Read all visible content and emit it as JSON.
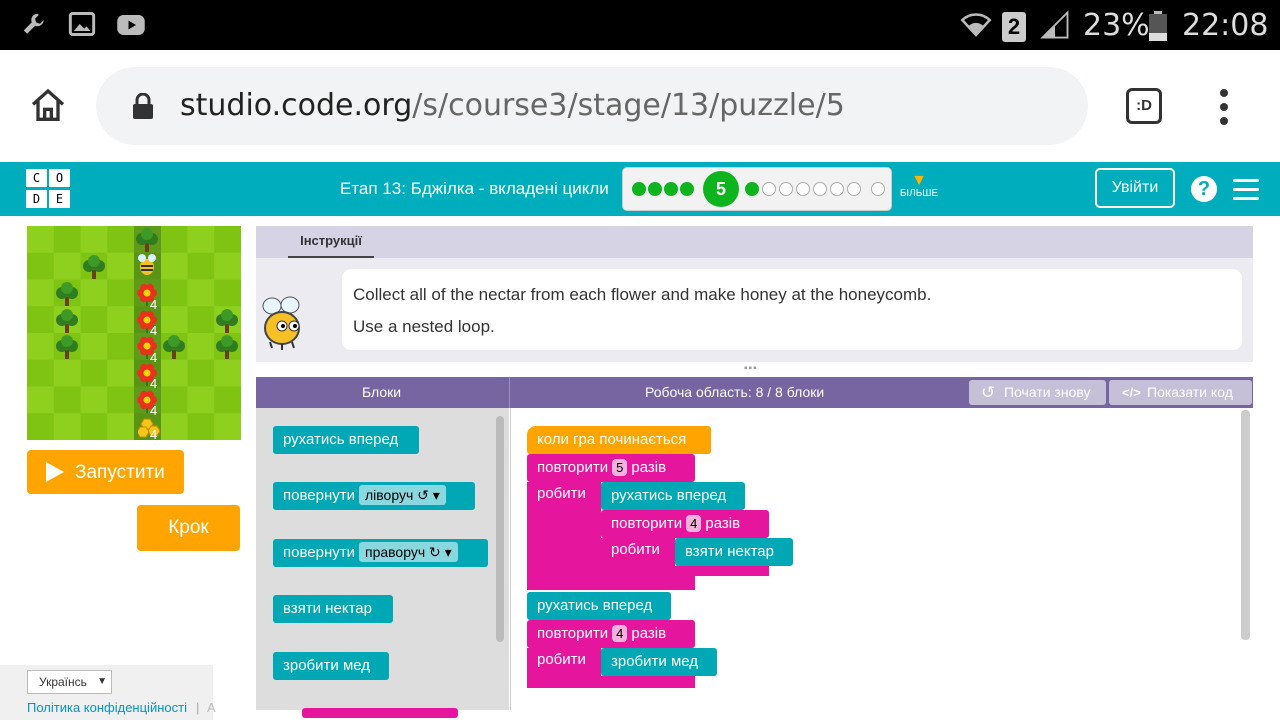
{
  "status_bar": {
    "battery": "23%",
    "time": "22:08",
    "sim": "2"
  },
  "browser": {
    "url_host": "studio.code.org",
    "url_path": "/s/course3/stage/13/puzzle/5",
    "tab_icon": ":D"
  },
  "header": {
    "logo_letters": [
      "C",
      "O",
      "D",
      "E"
    ],
    "stage_title": "Етап 13: Бджілка - вкладені цикли",
    "current_level": "5",
    "completed_levels": 4,
    "remaining_levels": 9,
    "more_label": "БІЛЬШЕ",
    "signin_label": "Увійти",
    "help_label": "?"
  },
  "game": {
    "flower_counts": [
      "4",
      "4",
      "4",
      "4",
      "4"
    ],
    "honeycomb_count": "4",
    "run_label": "Запустити",
    "step_label": "Крок"
  },
  "footer": {
    "language": "Українсь",
    "privacy": "Політика конфіденційності",
    "sep": "|",
    "more": "A"
  },
  "instructions": {
    "tab_label": "Інструкції",
    "line1": "Collect all of the nectar from each flower and make honey at the honeycomb.",
    "line2": "Use a nested loop."
  },
  "workspace_header": {
    "blocks_label": "Блоки",
    "workspace_label": "Робоча область: 8 / 8 блоки",
    "restart_label": "Почати знову",
    "show_code_label": "Показати код"
  },
  "toolbox": {
    "move_forward": "рухатись вперед",
    "turn_left": "повернути",
    "turn_left_dir": "ліворуч ↺",
    "turn_right": "повернути",
    "turn_right_dir": "праворуч ↻",
    "get_nectar": "взяти нектар",
    "make_honey": "зробити мед"
  },
  "program": {
    "when_run": "коли гра починається",
    "repeat": "повторити",
    "times": "разів",
    "do": "робити",
    "outer_count": "5",
    "inner_count": "4",
    "second_count": "4",
    "move_forward": "рухатись вперед",
    "get_nectar": "взяти нектар",
    "make_honey": "зробити мед"
  },
  "colors": {
    "header": "#00adbc",
    "orange_button": "#ffa400",
    "loop_block": "#e5169d",
    "action_block": "#00a8b5",
    "event_block": "#ffa400",
    "workspace_header": "#7665a0"
  }
}
